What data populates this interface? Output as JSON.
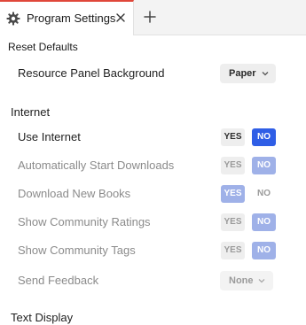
{
  "tab": {
    "title": "Program Settings",
    "gear_icon": "gear-icon",
    "close_icon": "close-icon",
    "add_icon": "plus-icon"
  },
  "reset_label": "Reset Defaults",
  "resource_panel": {
    "label": "Resource Panel Background",
    "value": "Paper"
  },
  "internet": {
    "heading": "Internet",
    "rows": [
      {
        "label": "Use Internet",
        "yes": "YES",
        "no": "NO",
        "selected": "no",
        "enabled": true
      },
      {
        "label": "Automatically Start Downloads",
        "yes": "YES",
        "no": "NO",
        "selected": "no",
        "enabled": false
      },
      {
        "label": "Download New Books",
        "yes": "YES",
        "no": "NO",
        "selected": "yes",
        "enabled": false
      },
      {
        "label": "Show Community Ratings",
        "yes": "YES",
        "no": "NO",
        "selected": "no",
        "enabled": false
      },
      {
        "label": "Show Community Tags",
        "yes": "YES",
        "no": "NO",
        "selected": "no",
        "enabled": false
      }
    ],
    "send_feedback": {
      "label": "Send Feedback",
      "value": "None"
    }
  },
  "next_section_heading": "Text Display",
  "colors": {
    "tab_accent": "#e0473a",
    "toggle_on": "#2f5ee6",
    "toggle_on_disabled": "#9fb1e8"
  }
}
